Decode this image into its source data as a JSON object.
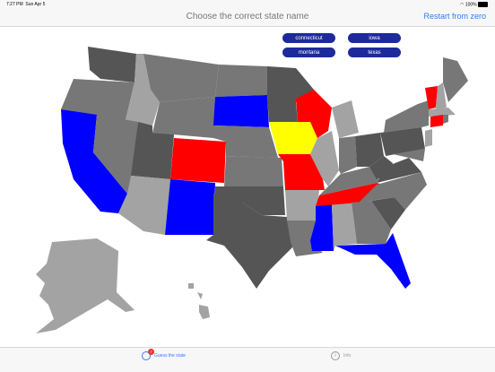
{
  "status": {
    "time": "7:27 PM",
    "date": "Sun Apr 5",
    "battery": "100%"
  },
  "nav": {
    "title": "Choose the correct state name",
    "restart_label": "Restart from zero"
  },
  "choices": [
    "connecticut",
    "iowa",
    "montana",
    "texas"
  ],
  "colors": {
    "accent": "#2f7ef6",
    "choice_bg": "#1d2a9c",
    "blue_state": "#0000ff",
    "red_state": "#ff0000",
    "yellow_state": "#ffff00",
    "dark_gray": "#555555",
    "mid_gray": "#777777",
    "light_gray": "#a3a3a3"
  },
  "tabs": [
    {
      "label": "Guess the state",
      "icon": "globe-icon",
      "badge": "7"
    },
    {
      "label": "Info",
      "icon": "info-icon"
    }
  ]
}
